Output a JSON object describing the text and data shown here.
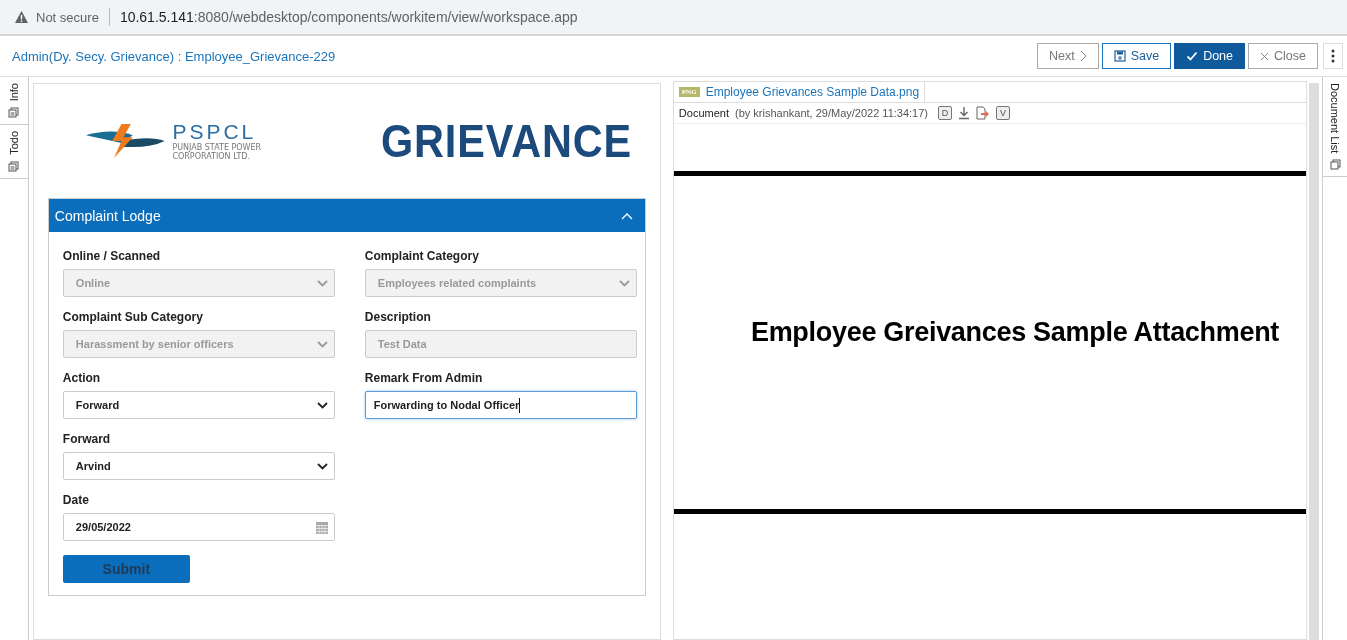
{
  "address_bar": {
    "security": "Not secure",
    "url_host": "10.61.5.141",
    "url_path": ":8080/webdesktop/components/workitem/view/workspace.app"
  },
  "header": {
    "title": "Admin(Dy. Secy. Grievance) : Employee_Grievance-229",
    "buttons": [
      {
        "label": "Next",
        "kind": "next",
        "primary": false
      },
      {
        "label": "Save",
        "kind": "save",
        "primary": false
      },
      {
        "label": "Done",
        "kind": "done",
        "primary": true
      },
      {
        "label": "Close",
        "kind": "close",
        "primary": false
      }
    ]
  },
  "left_rail": [
    {
      "label": "Info"
    },
    {
      "label": "Todo"
    }
  ],
  "right_rail": {
    "label": "Document List"
  },
  "logo": {
    "name": "PSPCL",
    "line_1": "PUNJAB STATE POWER",
    "line_2": "CORPORATION LTD.",
    "banner": "GRIEVANCE"
  },
  "section": {
    "title": "Complaint Lodge",
    "expanded": true,
    "columns": [
      {
        "fields": [
          {
            "label": "Online / Scanned",
            "value": "Online",
            "kind": "select",
            "disabled": true,
            "focused": false
          },
          {
            "label": "Complaint Sub Category",
            "value": "Harassment by senior officers",
            "kind": "select",
            "disabled": true,
            "focused": false
          },
          {
            "label": "Action",
            "value": "Forward",
            "kind": "select",
            "disabled": false,
            "focused": false
          },
          {
            "label": "Forward",
            "value": "Arvind",
            "kind": "select",
            "disabled": false,
            "focused": false
          },
          {
            "label": "Date",
            "value": "29/05/2022",
            "kind": "date",
            "disabled": false,
            "focused": false
          }
        ]
      },
      {
        "fields": [
          {
            "label": "Complaint Category",
            "value": "Employees related complaints",
            "kind": "select",
            "disabled": true,
            "focused": false
          },
          {
            "label": "Description",
            "value": "Test Data",
            "kind": "text",
            "disabled": true,
            "focused": false
          },
          {
            "label": "Remark From Admin",
            "value": "Forwarding to Nodal Officer",
            "kind": "text",
            "disabled": false,
            "focused": true
          }
        ]
      }
    ],
    "submit": "Submit"
  },
  "document": {
    "tab": {
      "badge": "PNG",
      "name": "Employee Grievances Sample Data.png"
    },
    "type": "Document",
    "meta": "(by krishankant, 29/May/2022 11:34:17)",
    "actions": [
      {
        "kind": "letter",
        "label": "D"
      },
      {
        "kind": "download"
      },
      {
        "kind": "export"
      },
      {
        "kind": "letter",
        "label": "V"
      }
    ],
    "content": "Employee Greivances Sample Attachment"
  }
}
